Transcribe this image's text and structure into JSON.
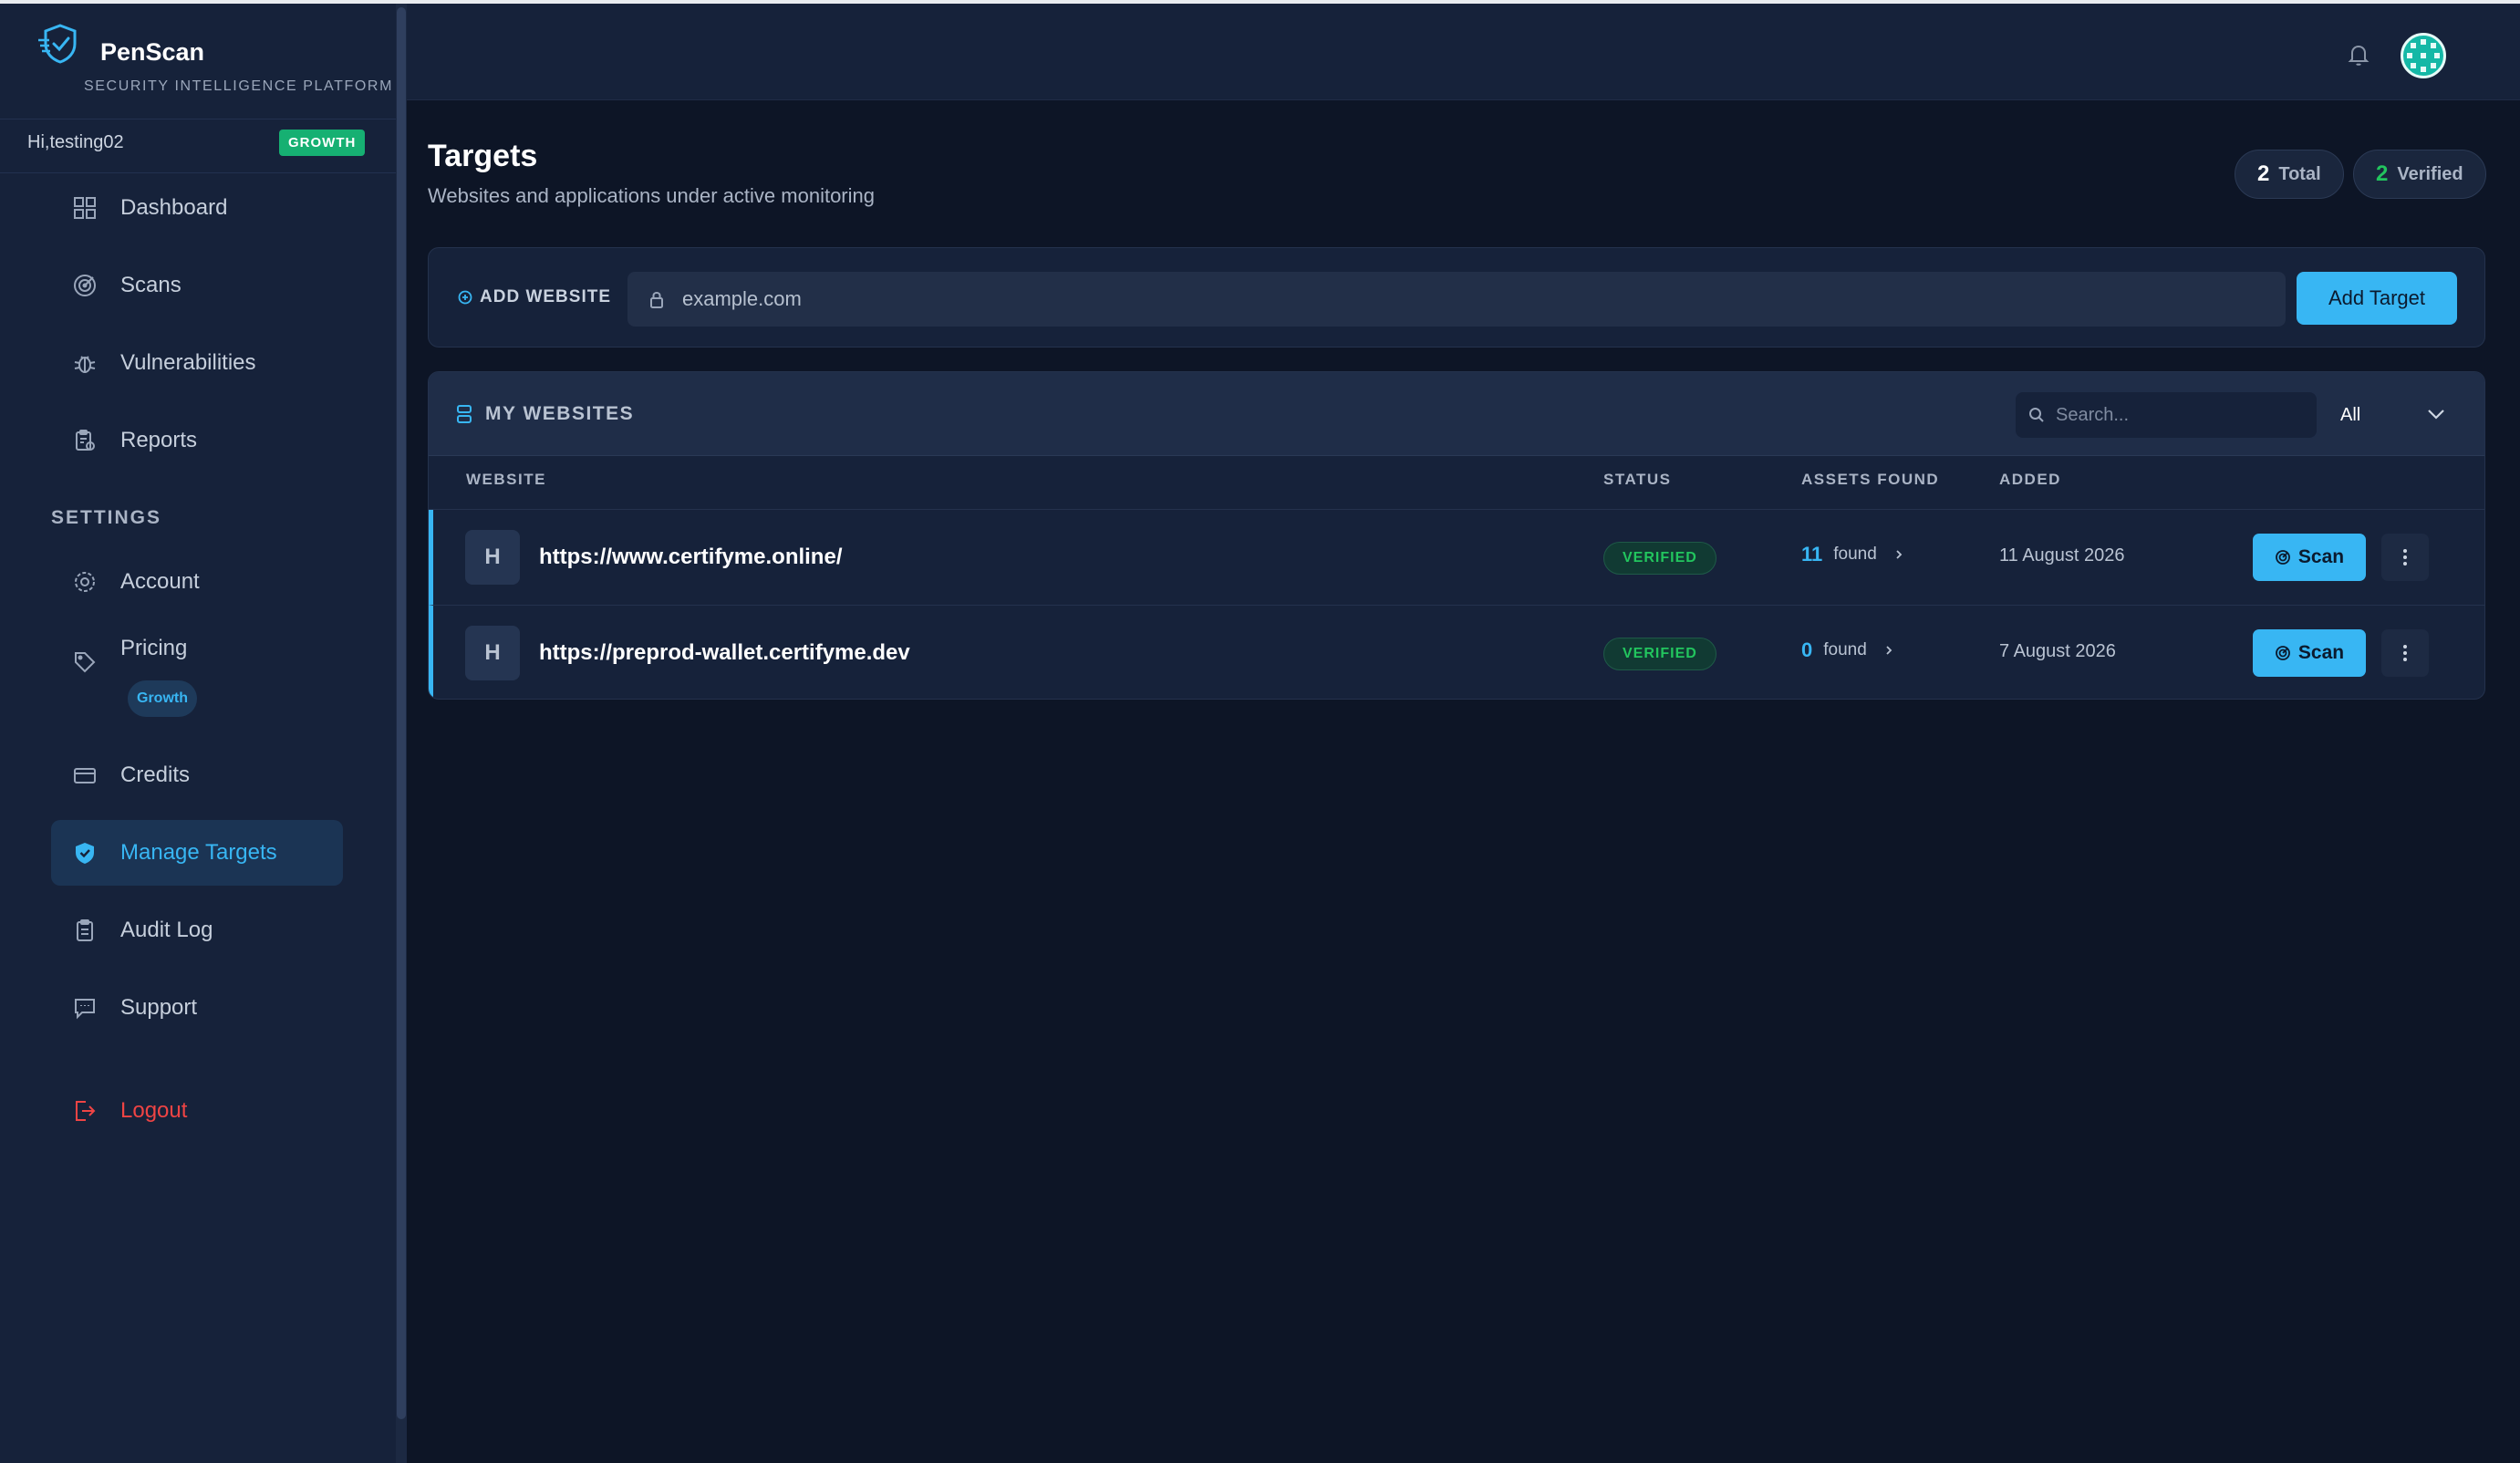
{
  "app": {
    "name": "PenScan",
    "tagline": "SECURITY INTELLIGENCE PLATFORM"
  },
  "user": {
    "greeting": "Hi,testing02",
    "plan": "GROWTH"
  },
  "sidebar": {
    "items": [
      {
        "label": "Dashboard",
        "icon": "grid-icon"
      },
      {
        "label": "Scans",
        "icon": "target-icon"
      },
      {
        "label": "Vulnerabilities",
        "icon": "bug-icon"
      },
      {
        "label": "Reports",
        "icon": "report-icon"
      }
    ],
    "settings_label": "SETTINGS",
    "settings_items": [
      {
        "label": "Account",
        "icon": "gear-icon"
      },
      {
        "label": "Pricing",
        "icon": "tag-icon",
        "badge": "Growth"
      },
      {
        "label": "Credits",
        "icon": "card-icon"
      },
      {
        "label": "Manage Targets",
        "icon": "shield-check-icon",
        "active": true
      },
      {
        "label": "Audit Log",
        "icon": "clipboard-icon"
      },
      {
        "label": "Support",
        "icon": "chat-icon"
      }
    ],
    "logout_label": "Logout"
  },
  "header": {
    "title": "Targets",
    "subtitle": "Websites and applications under active monitoring",
    "stats": {
      "total_count": "2",
      "total_label": "Total",
      "verified_count": "2",
      "verified_label": "Verified"
    }
  },
  "add_website": {
    "label": "ADD WEBSITE",
    "placeholder": "example.com",
    "button_label": "Add Target"
  },
  "websites": {
    "title": "MY WEBSITES",
    "search_placeholder": "Search...",
    "filter_value": "All",
    "columns": [
      "WEBSITE",
      "STATUS",
      "ASSETS FOUND",
      "ADDED"
    ],
    "rows": [
      {
        "initial": "H",
        "url": "https://www.certifyme.online/",
        "status": "VERIFIED",
        "assets_count": "11",
        "assets_label": "found",
        "added": "11 August 2026",
        "scan_label": "Scan"
      },
      {
        "initial": "H",
        "url": "https://preprod-wallet.certifyme.dev",
        "status": "VERIFIED",
        "assets_count": "0",
        "assets_label": "found",
        "added": "7 August 2026",
        "scan_label": "Scan"
      }
    ]
  },
  "colors": {
    "accent": "#38b6f3",
    "success": "#22c55e",
    "danger": "#ef4444",
    "sidebar_bg": "#16223a",
    "page_bg": "#0d1526"
  }
}
